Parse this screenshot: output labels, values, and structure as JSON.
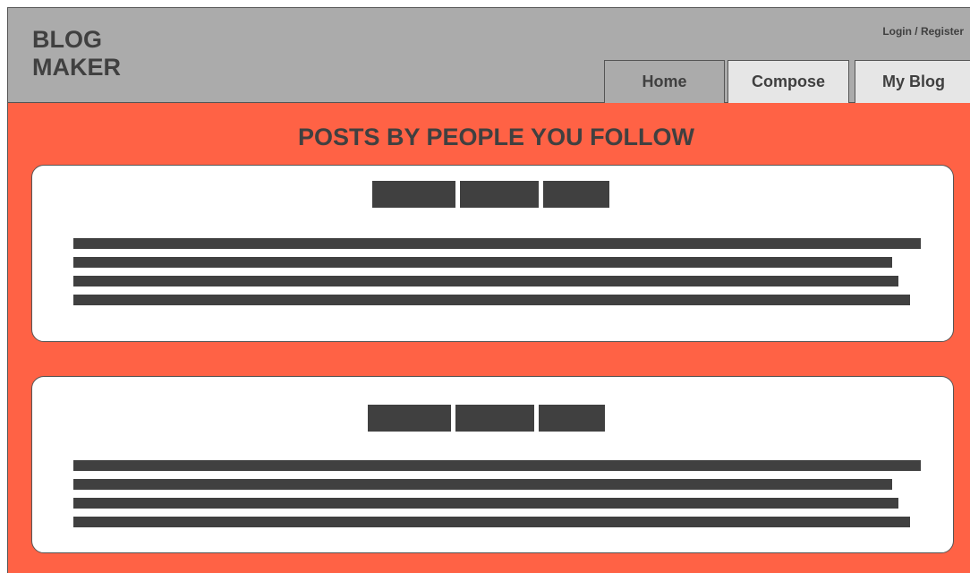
{
  "header": {
    "logo_line1": "BLOG",
    "logo_line2": "MAKER",
    "login_register": "Login / Register",
    "tabs": [
      {
        "label": "Home",
        "active": true
      },
      {
        "label": "Compose",
        "active": false
      },
      {
        "label": "My Blog",
        "active": false
      }
    ]
  },
  "main": {
    "section_title": "POSTS BY PEOPLE YOU FOLLOW"
  },
  "colors": {
    "header_bg": "#ababab",
    "content_bg": "#ff6245",
    "text_dark": "#404040",
    "inactive_tab_bg": "#e6e6e6"
  }
}
